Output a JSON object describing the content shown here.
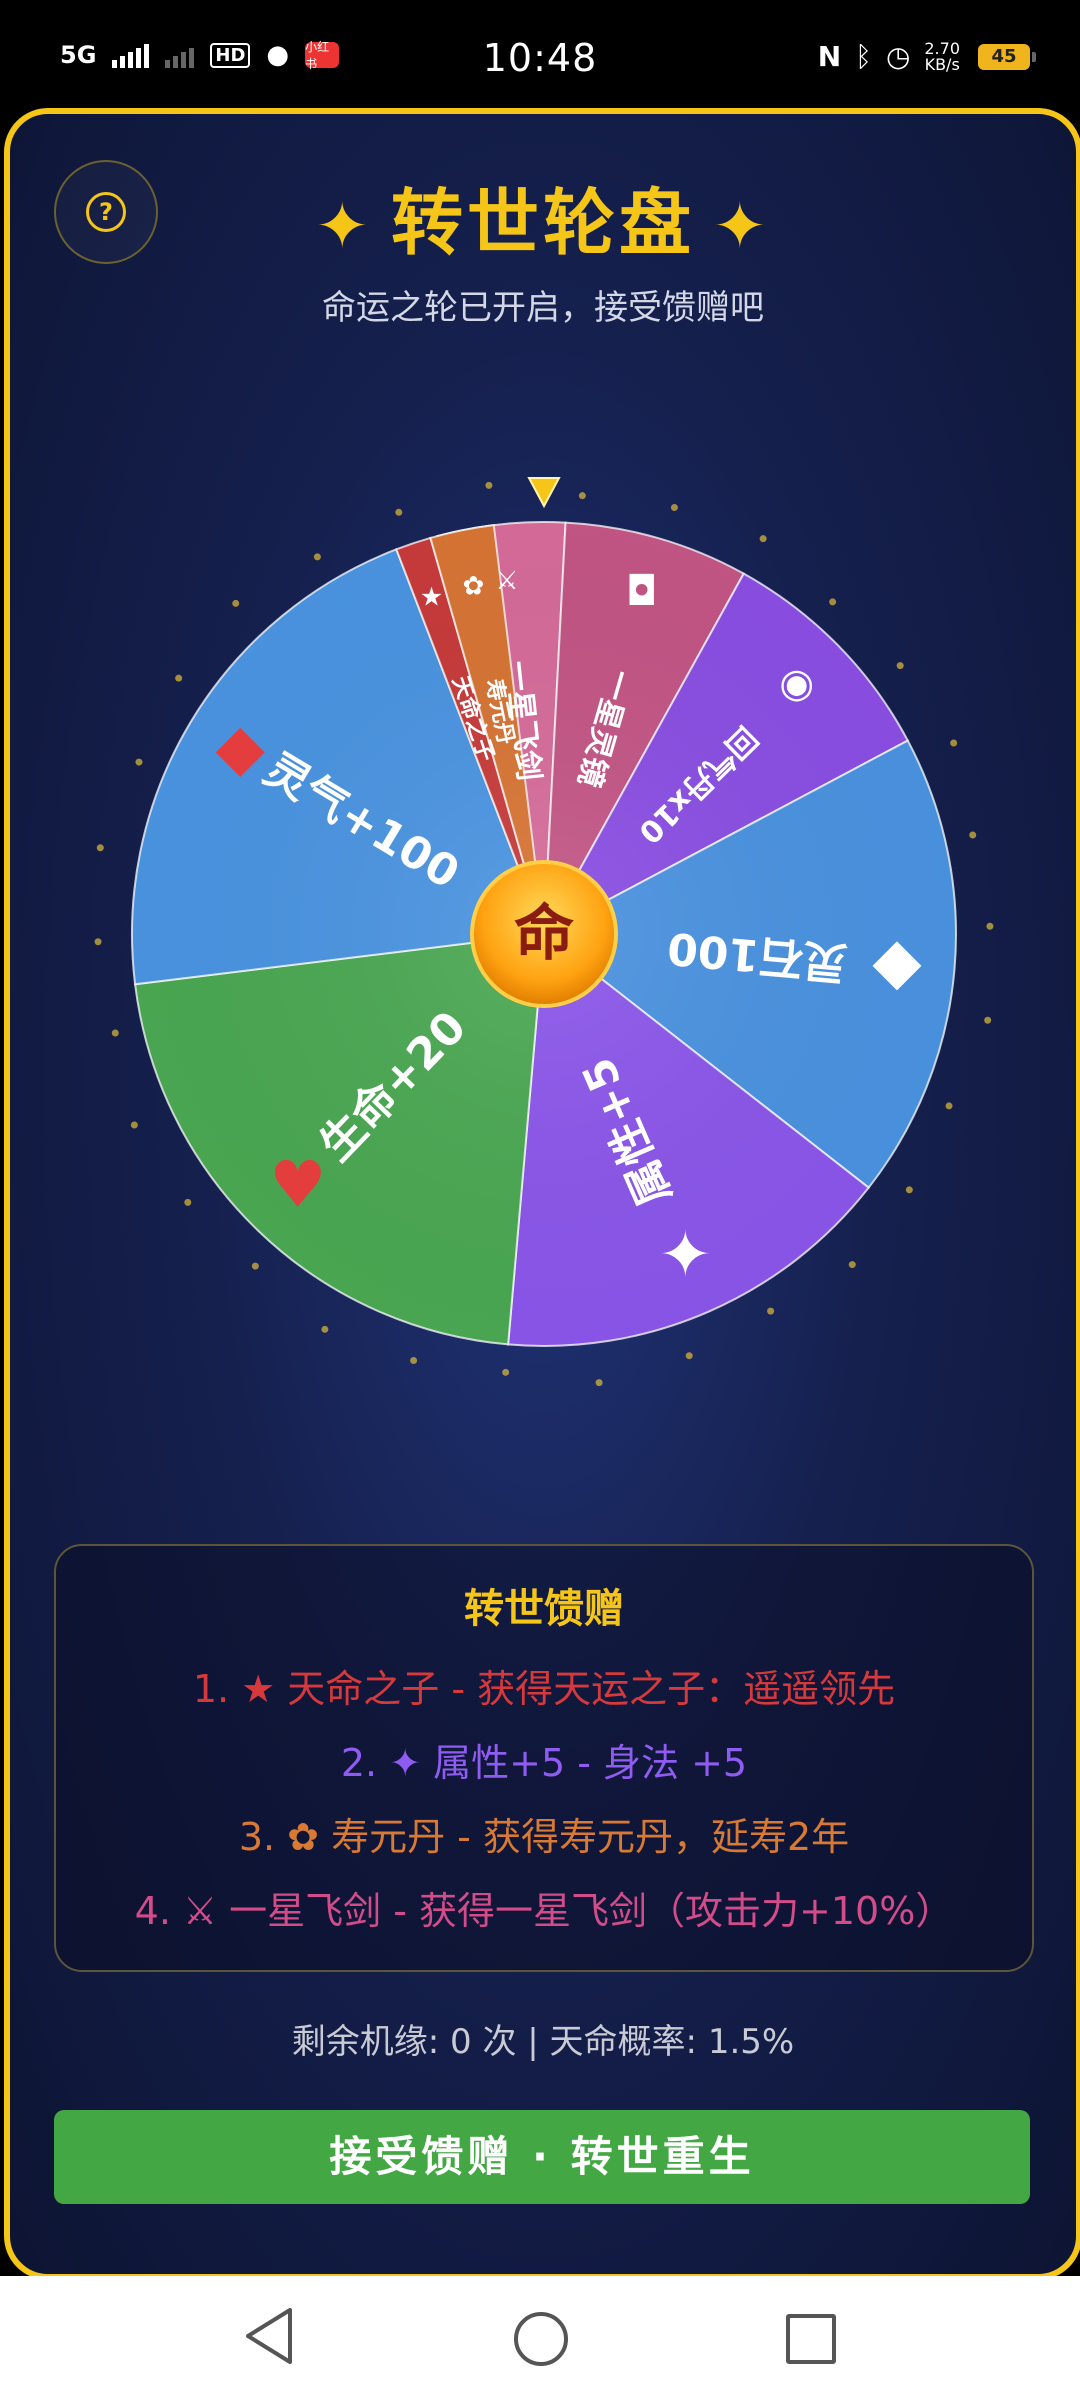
{
  "status_bar": {
    "network": "5G",
    "hd": "HD",
    "time": "10:48",
    "speed_value": "2.70",
    "speed_unit": "KB/s",
    "battery": "45",
    "app_badge": "小红书"
  },
  "header": {
    "title": "转世轮盘",
    "sparkle_left": "✦",
    "sparkle_right": "✦",
    "subtitle": "命运之轮已开启，接受馈赠吧"
  },
  "wheel": {
    "center_label": "命",
    "segments": [
      {
        "label": "一星飞剑",
        "icon": "⚔",
        "color": "#d66b9a"
      },
      {
        "label": "一星灵镜",
        "icon": "◘",
        "color": "#c35585"
      },
      {
        "label": "回气丹x10",
        "icon": "◉",
        "color": "#8a4ee3"
      },
      {
        "label": "灵石100",
        "icon": "◆",
        "color": "#4a92e0"
      },
      {
        "label": "属性+5",
        "icon": "✦",
        "color": "#8b56ea"
      },
      {
        "label": "生命+20",
        "icon": "♥",
        "color": "#4aa852"
      },
      {
        "label": "灵气+100",
        "icon": "◆",
        "color": "#4a94e1"
      },
      {
        "label": "天命之子",
        "icon": "★",
        "color": "#c83a3a"
      },
      {
        "label": "寿元丹",
        "icon": "✿",
        "color": "#d77434"
      }
    ]
  },
  "rewards": {
    "title": "转世馈赠",
    "items": [
      {
        "text": "1. ★ 天命之子 - 获得天运之子：遥遥领先",
        "color": "#d6393b"
      },
      {
        "text": "2. ✦ 属性+5 - 身法 +5",
        "color": "#8e5cf0"
      },
      {
        "text": "3. ✿ 寿元丹 - 获得寿元丹，延寿2年",
        "color": "#d87a33"
      },
      {
        "text": "4. ⚔ 一星飞剑 - 获得一星飞剑（攻击力+10%）",
        "color": "#d24c8a"
      }
    ]
  },
  "remaining": "剩余机缘: 0 次 | 天命概率: 1.5%",
  "action_button": "接受馈赠 · 转世重生"
}
